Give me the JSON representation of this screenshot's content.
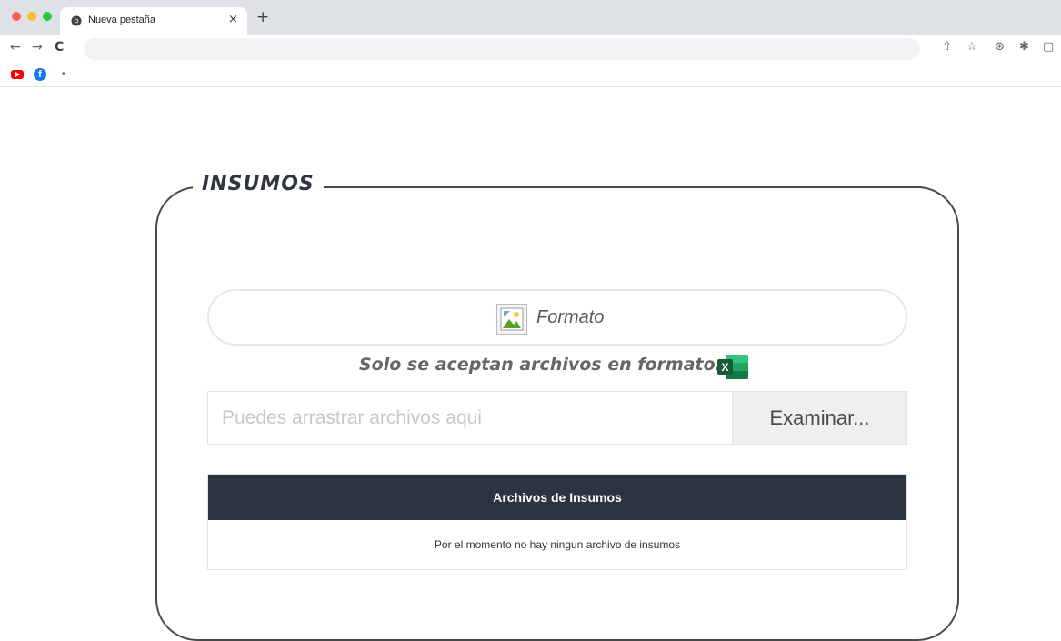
{
  "browser": {
    "tab_title": "Nueva pestaña",
    "tab_close": "×",
    "new_tab": "+",
    "back": "←",
    "forward": "→",
    "reload": "C",
    "toolbar_icons": {
      "share": "⇧",
      "bookmark_star": "☆",
      "extension_a": "⊛",
      "extensions": "✱",
      "sidebar": "▢"
    },
    "bookmarks": {
      "facebook_glyph": "f",
      "more": "•"
    }
  },
  "panel": {
    "title": "INSUMOS",
    "formato_button": "Formato",
    "accept_note": "Solo se aceptan archivos en formato:",
    "excel_icon_letter": "X",
    "drop_placeholder": "Puedes arrastrar archivos aqui",
    "browse_button": "Examinar...",
    "table_header": "Archivos de Insumos",
    "table_empty": "Por el momento no hay ningun archivo de insumos"
  },
  "colors": {
    "header_dark": "#2b3440",
    "excel_green": "#1d6f42",
    "title_text": "#2f3640"
  }
}
